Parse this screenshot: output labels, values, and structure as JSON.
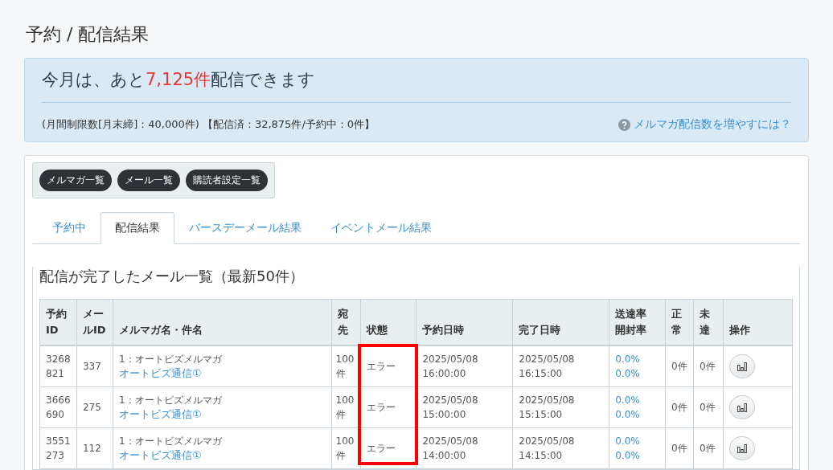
{
  "page_title": "予約 / 配信結果",
  "quota": {
    "headline_before": "今月は、あと",
    "headline_count": "7,125件",
    "headline_after": "配信できます",
    "detail": "(月間制限数[月末締]：40,000件) 【配信済：32,875件/予約中：0件】",
    "help_link": "メルマガ配信数を増やすには？"
  },
  "nav_buttons": [
    "メルマガ一覧",
    "メール一覧",
    "購読者設定一覧"
  ],
  "tabs": [
    {
      "label": "予約中",
      "selected": false
    },
    {
      "label": "配信結果",
      "selected": true
    },
    {
      "label": "バースデーメール結果",
      "selected": false
    },
    {
      "label": "イベントメール結果",
      "selected": false
    }
  ],
  "section_title": "配信が完了したメール一覧（最新50件）",
  "table": {
    "columns": [
      "予約ID",
      "メールID",
      "メルマガ名・件名",
      "宛先",
      "状態",
      "予約日時",
      "完了日時",
      "送達率開封率",
      "正常",
      "未達",
      "操作"
    ],
    "rows": [
      {
        "reservation_id": "3268821",
        "mail_id": "337",
        "magazine": "1：オートビズメルマガ",
        "subject": "オートビズ通信①",
        "recipients": "100件",
        "status": "エラー",
        "scheduled": "2025/05/08 16:00:00",
        "completed": "2025/05/08 16:15:00",
        "delivery_rate": "0.0%",
        "open_rate": "0.0%",
        "normal": "0件",
        "failed": "0件"
      },
      {
        "reservation_id": "3666690",
        "mail_id": "275",
        "magazine": "1：オートビズメルマガ",
        "subject": "オートビズ通信①",
        "recipients": "100件",
        "status": "エラー",
        "scheduled": "2025/05/08 15:00:00",
        "completed": "2025/05/08 15:15:00",
        "delivery_rate": "0.0%",
        "open_rate": "0.0%",
        "normal": "0件",
        "failed": "0件"
      },
      {
        "reservation_id": "3551273",
        "mail_id": "112",
        "magazine": "1：オートビズメルマガ",
        "subject": "オートビズ通信①",
        "recipients": "100件",
        "status": "エラー",
        "scheduled": "2025/05/08 14:00:00",
        "completed": "2025/05/08 14:15:00",
        "delivery_rate": "0.0%",
        "open_rate": "0.0%",
        "normal": "0件",
        "failed": "0件"
      }
    ]
  },
  "annotation": {
    "kind": "box",
    "color": "#ff0000"
  }
}
